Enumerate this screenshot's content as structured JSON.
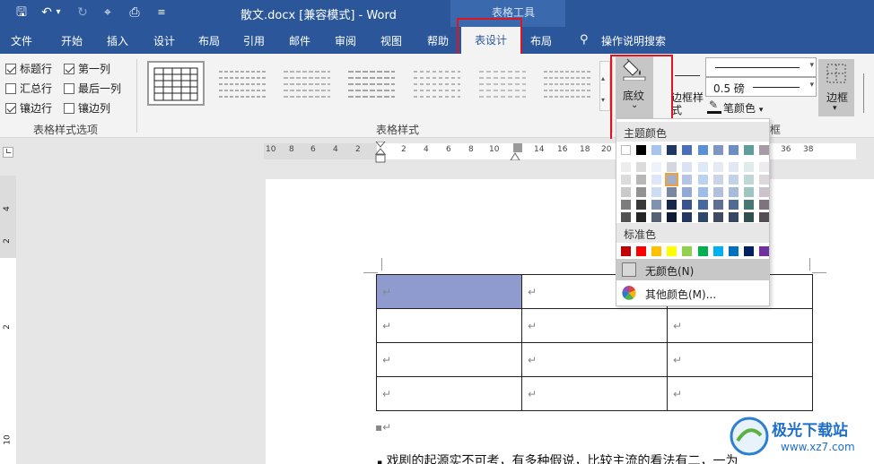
{
  "window": {
    "title": "散文.docx [兼容模式]  -  Word",
    "tools_title": "表格工具"
  },
  "quick_access": [
    {
      "icon": "save-icon",
      "glyph": "🖫"
    },
    {
      "icon": "undo-icon",
      "glyph": "↶"
    },
    {
      "icon": "dropdown-icon",
      "glyph": "▾"
    },
    {
      "icon": "redo-icon",
      "glyph": "↻"
    },
    {
      "icon": "format-painter-icon",
      "glyph": "⌖"
    },
    {
      "icon": "print-preview-icon",
      "glyph": "⎙"
    },
    {
      "icon": "customize-icon",
      "glyph": "≡"
    }
  ],
  "tabs": [
    "文件",
    "开始",
    "插入",
    "设计",
    "布局",
    "引用",
    "邮件",
    "审阅",
    "视图",
    "帮助",
    "表设计",
    "布局"
  ],
  "active_tab": "表设计",
  "tell_me": "操作说明搜索",
  "style_options": {
    "items": [
      {
        "label": "标题行",
        "checked": true
      },
      {
        "label": "第一列",
        "checked": true
      },
      {
        "label": "汇总行",
        "checked": false
      },
      {
        "label": "最后一列",
        "checked": false
      },
      {
        "label": "镶边行",
        "checked": true
      },
      {
        "label": "镶边列",
        "checked": false
      }
    ],
    "group_label": "表格样式选项"
  },
  "table_styles": {
    "group_label": "表格样式"
  },
  "shading": {
    "label": "底纹",
    "caret": "⌄"
  },
  "borders": {
    "border_styles_label": "边框样",
    "border_styles_label2": "式",
    "weight": "0.5 磅",
    "pen_color_label": "笔颜色",
    "borders_label": "边框",
    "group_label": "框"
  },
  "color_menu": {
    "theme_header": "主题颜色",
    "standard_header": "标准色",
    "no_color": "无颜色(N)",
    "more_colors": "其他颜色(M)...",
    "theme_top": [
      "#ffffff",
      "#000000",
      "#a9c4eb",
      "#1f3763",
      "#4a6ebc",
      "#5b8fd6",
      "#7f96c4",
      "#6c8ec2",
      "#5f9e9b",
      "#a99aa8"
    ],
    "standard": [
      "#c00000",
      "#ff0000",
      "#ffc000",
      "#ffff00",
      "#92d050",
      "#00b050",
      "#00b0f0",
      "#0070c0",
      "#002060",
      "#7030a0"
    ]
  },
  "ruler": {
    "h_numbers": [
      "10",
      "8",
      "6",
      "4",
      "2",
      "2",
      "4",
      "6",
      "8",
      "10",
      "14",
      "16",
      "18",
      "20",
      "36",
      "38"
    ],
    "v_numbers": [
      "4",
      "2",
      "2",
      "10"
    ]
  },
  "document": {
    "table": [
      [
        "↵",
        "↵",
        "↵"
      ],
      [
        "↵",
        "↵",
        "↵"
      ],
      [
        "↵",
        "↵",
        "↵"
      ],
      [
        "↵",
        "↵",
        "↵"
      ]
    ],
    "empty_para": "↵",
    "body_line": "戏剧的起源实不可考，有多种假说，比较主流的看法有二，一为"
  },
  "watermark": {
    "text": "极光下载站",
    "url": "www.xz7.com"
  }
}
